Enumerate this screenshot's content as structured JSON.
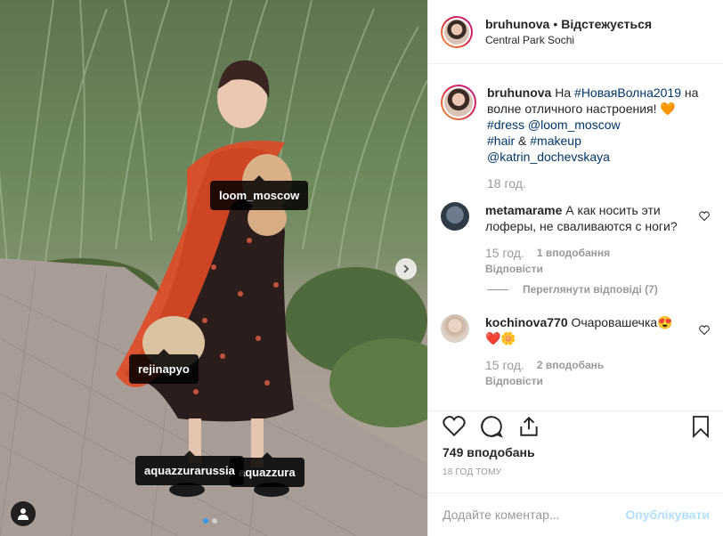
{
  "header": {
    "username": "bruhunova",
    "separator": "•",
    "follow_status": "Відстежується",
    "location": "Central Park Sochi"
  },
  "photo": {
    "tags": [
      "loom_moscow",
      "rejinapyo",
      "aquazzurarussia",
      "aquazzura"
    ],
    "carousel_count": 2,
    "carousel_active": 1
  },
  "caption": {
    "username": "bruhunova",
    "text_1": "На",
    "hashtag_1": "#НоваяВолна2019",
    "text_2": "на волне отличного настроения!",
    "emoji": "🧡",
    "hashtag_2": "#dress",
    "mention_1": "@loom_moscow",
    "hashtag_3": "#hair",
    "amp": "&",
    "hashtag_4": "#makeup",
    "mention_2": "@katrin_dochevskaya",
    "time": "18 год."
  },
  "comments": [
    {
      "username": "metamarame",
      "text": "А как носить эти лоферы, не сваливаются с ноги?",
      "time": "15 год.",
      "likes": "1 вподобання",
      "reply": "Відповісти"
    },
    {
      "username": "kochinova770",
      "text": "Очаровашечка😍",
      "text_2": "❤️🌼",
      "time": "15 год.",
      "likes": "2 вподобань",
      "reply": "Відповісти"
    }
  ],
  "view_replies": "Переглянути відповіді (7)",
  "likes_count": "749 вподобань",
  "posted_ago": "18 ГОД ТОМУ",
  "add_comment": {
    "placeholder": "Додайте коментар...",
    "post_label": "Опублікувати"
  },
  "colors": {
    "link": "#003569",
    "muted": "#999999",
    "post_disabled": "#b2dffc",
    "active_dot": "#3897f0"
  }
}
